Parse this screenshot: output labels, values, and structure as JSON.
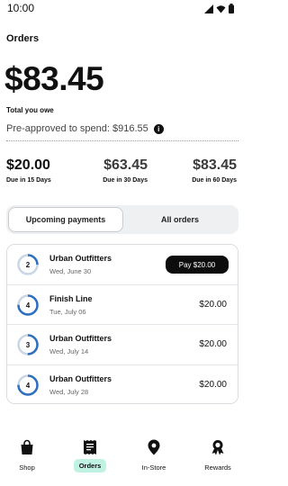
{
  "status_bar": {
    "time": "10:00"
  },
  "page": {
    "title": "Orders",
    "total_amount": "$83.45",
    "total_label": "Total you owe",
    "preapproved_text": "Pre-approved to spend: $916.55",
    "info_glyph": "i"
  },
  "due": [
    {
      "amount": "$20.00",
      "label": "Due in 15 Days"
    },
    {
      "amount": "$63.45",
      "label": "Due in 30 Days"
    },
    {
      "amount": "$83.45",
      "label": "Due in 60 Days"
    }
  ],
  "tabs": [
    {
      "label": "Upcoming payments",
      "active": true
    },
    {
      "label": "All orders",
      "active": false
    }
  ],
  "payments": [
    {
      "number": "2",
      "merchant": "Urban Outfitters",
      "date": "Wed, June 30",
      "action_label": "Pay $20.00",
      "progress_fraction": 0.25
    },
    {
      "number": "4",
      "merchant": "Finish Line",
      "date": "Tue, July 06",
      "amount": "$20.00",
      "progress_fraction": 0.75
    },
    {
      "number": "3",
      "merchant": "Urban Outfitters",
      "date": "Wed, July 14",
      "amount": "$20.00",
      "progress_fraction": 0.5
    },
    {
      "number": "4",
      "merchant": "Urban Outfitters",
      "date": "Wed, July 28",
      "amount": "$20.00",
      "progress_fraction": 0.75
    }
  ],
  "nav": [
    {
      "label": "Shop",
      "icon": "shopping-bag-icon"
    },
    {
      "label": "Orders",
      "icon": "receipt-icon",
      "active": true
    },
    {
      "label": "In-Store",
      "icon": "location-pin-icon"
    },
    {
      "label": "Rewards",
      "icon": "award-ribbon-icon"
    }
  ],
  "colors": {
    "progress_accent": "#2e6fbf",
    "progress_track": "#c9d6e6",
    "active_nav_highlight": "#bff2e2",
    "primary": "#0d0d0d"
  }
}
